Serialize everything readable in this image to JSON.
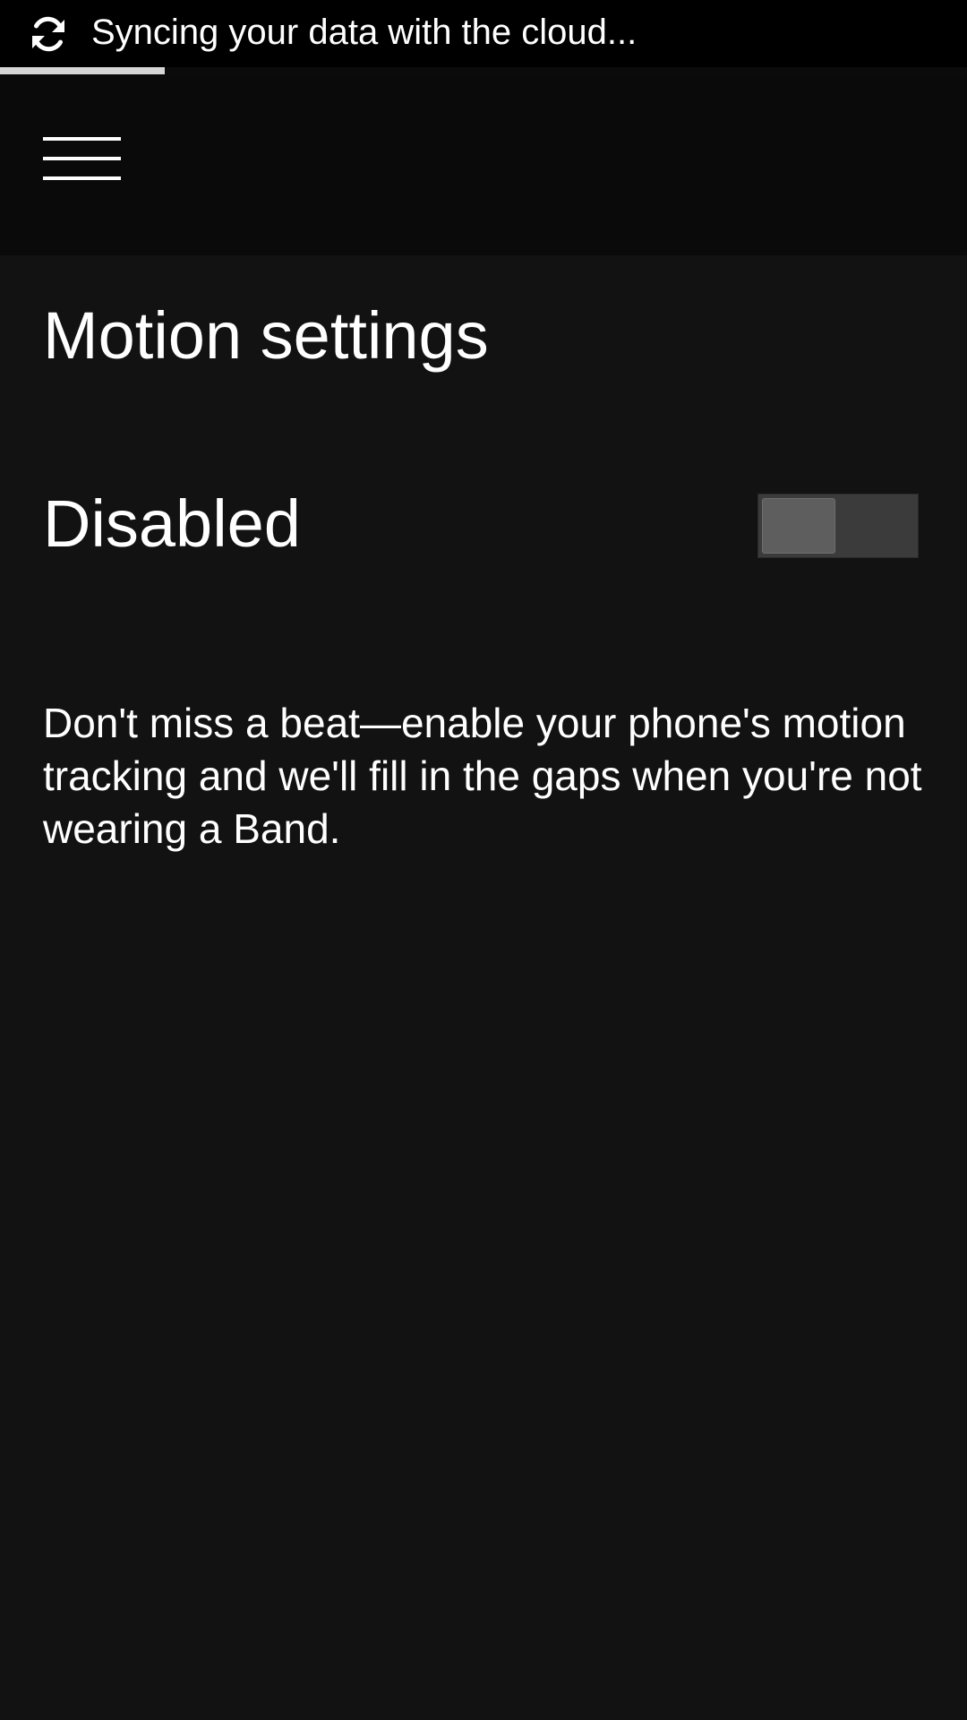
{
  "status_bar": {
    "icon": "sync-icon",
    "text": "Syncing your data with the cloud...",
    "progress_percent": 17
  },
  "header": {
    "menu_icon": "hamburger-menu-icon"
  },
  "page": {
    "title": "Motion settings"
  },
  "motion_toggle": {
    "label": "Disabled",
    "enabled": false
  },
  "description": "Don't miss a beat—enable your phone's motion tracking and we'll fill in the gaps when you're not wearing a Band.",
  "colors": {
    "background": "#121212",
    "header_background": "#0a0a0a",
    "status_background": "#000000",
    "toggle_track": "#3b3b3b",
    "toggle_knob": "#5e5e5e",
    "progress_fill": "#d6d6d6"
  }
}
